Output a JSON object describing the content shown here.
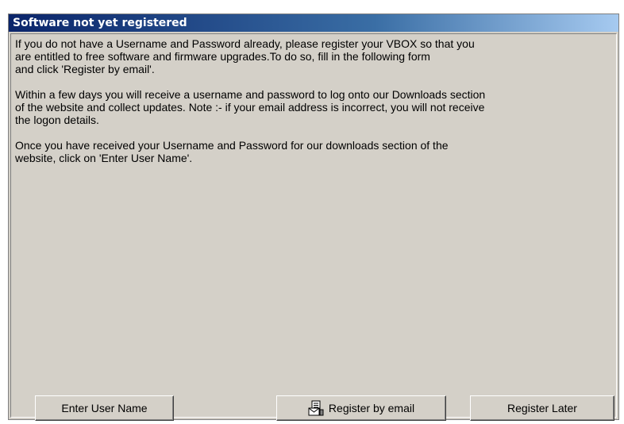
{
  "dialog": {
    "title": "Software not yet registered",
    "paragraphs": [
      "If you do not have a Username and Password already, please register your VBOX so that you\nare entitled to free software and firmware upgrades.To do so, fill in the following form\nand click 'Register by email'.",
      "Within a few days you will receive a username and password to log onto our Downloads section\nof the website and collect updates.  Note :- if your email address is incorrect, you will not receive\nthe logon details.",
      "Once you have received your Username and Password for our downloads section of the\nwebsite, click on 'Enter User Name'."
    ]
  },
  "buttons": {
    "enter_user_name": "Enter User Name",
    "register_by_email": "Register by email",
    "register_later": "Register Later"
  },
  "icons": {
    "register_by_email": "document-with-envelope-icon"
  }
}
